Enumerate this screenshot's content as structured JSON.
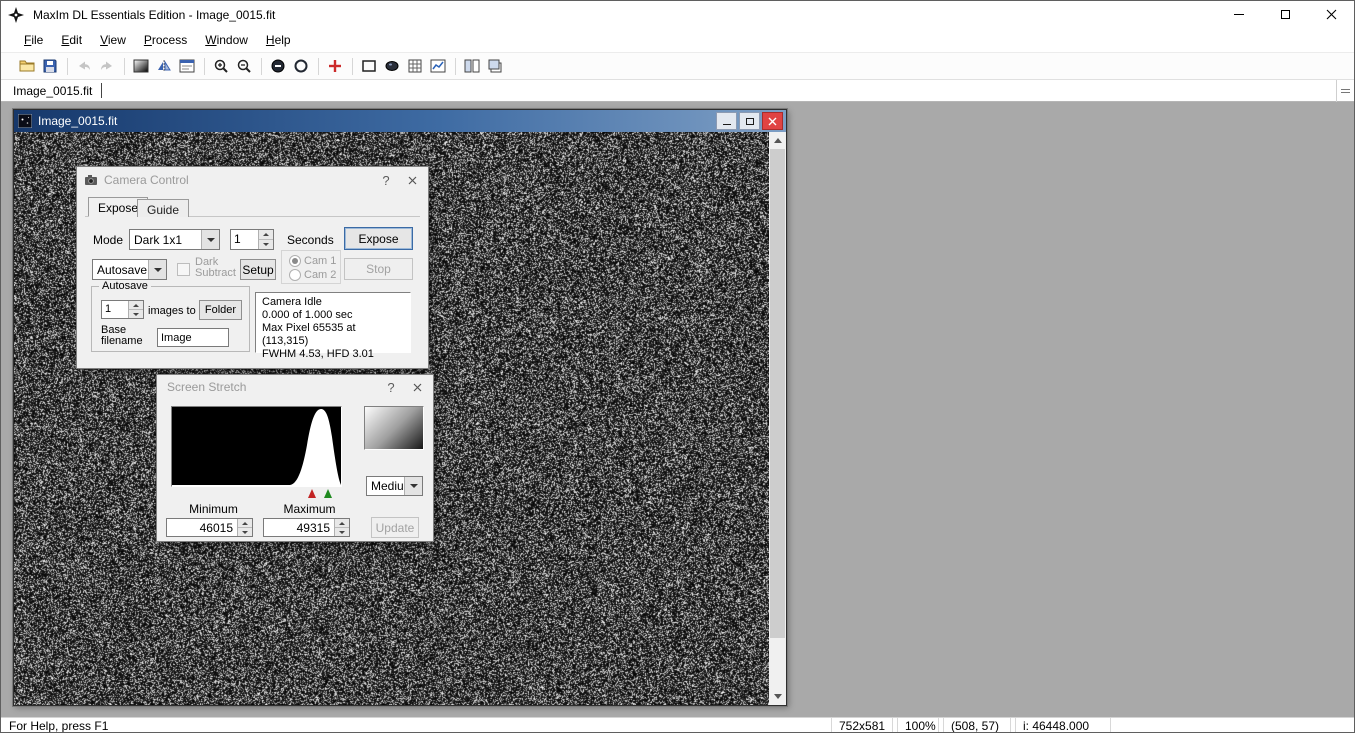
{
  "window": {
    "title": "MaxIm DL Essentials Edition - Image_0015.fit",
    "control_icons": [
      "minimize",
      "maximize",
      "close"
    ]
  },
  "menu": {
    "items": [
      {
        "label": "File"
      },
      {
        "label": "Edit"
      },
      {
        "label": "View"
      },
      {
        "label": "Process"
      },
      {
        "label": "Window"
      },
      {
        "label": "Help"
      }
    ]
  },
  "toolbar": {
    "buttons": [
      "open",
      "save",
      "undo",
      "redo",
      "screen-stretch",
      "flip-vertical",
      "information-window",
      "zoom-in",
      "zoom-out",
      "zoom-reduce",
      "pan",
      "crosshair",
      "select-rectangle",
      "camera-control",
      "pixel-grid",
      "graph-window",
      "tile-windows",
      "cascade-windows"
    ]
  },
  "tab_bar": {
    "tabs": [
      {
        "label": "Image_0015.fit"
      }
    ]
  },
  "image_window": {
    "title": "Image_0015.fit"
  },
  "camera_control": {
    "title": "Camera Control",
    "help_glyph": "?",
    "tabs": [
      {
        "label": "Expose"
      },
      {
        "label": "Guide"
      }
    ],
    "mode_label": "Mode",
    "mode_value": "Dark 1x1",
    "exposure_value": "1",
    "seconds_label": "Seconds",
    "expose_button": "Expose",
    "autosave_mode_value": "Autosave",
    "dark_subtract_label": "Dark Subtract",
    "setup_button": "Setup",
    "cam1_label": "Cam 1",
    "cam2_label": "Cam 2",
    "stop_button": "Stop",
    "autosave_group": {
      "legend": "Autosave",
      "count_value": "1",
      "images_to_label": "images to",
      "folder_button": "Folder",
      "base_filename_label": "Base filename",
      "base_filename_value": "Image"
    },
    "status": {
      "line1": "Camera Idle",
      "line2": "0.000 of 1.000 sec",
      "line3": "Max Pixel 65535 at (113,315)",
      "line4": "FWHM 4.53, HFD 3.01"
    }
  },
  "screen_stretch": {
    "title": "Screen Stretch",
    "help_glyph": "?",
    "minimum_label": "Minimum",
    "maximum_label": "Maximum",
    "minimum_value": "46015",
    "maximum_value": "49315",
    "stretch_preset": "Medium",
    "update_button": "Update",
    "marker_icons": [
      "minimum-marker",
      "maximum-marker"
    ]
  },
  "status_bar": {
    "help_text": "For Help, press F1",
    "image_size": "752x581",
    "zoom": "100%",
    "cursor_position": "(508, 57)",
    "intensity": "i: 46448.000"
  },
  "colors": {
    "mdi_background": "#a9a9a9",
    "child_titlebar_start": "#16386b",
    "child_titlebar_end": "#7e9fc5",
    "close_button_red": "#e04343",
    "marker_red": "#c22424",
    "marker_green": "#1f8a1f"
  }
}
